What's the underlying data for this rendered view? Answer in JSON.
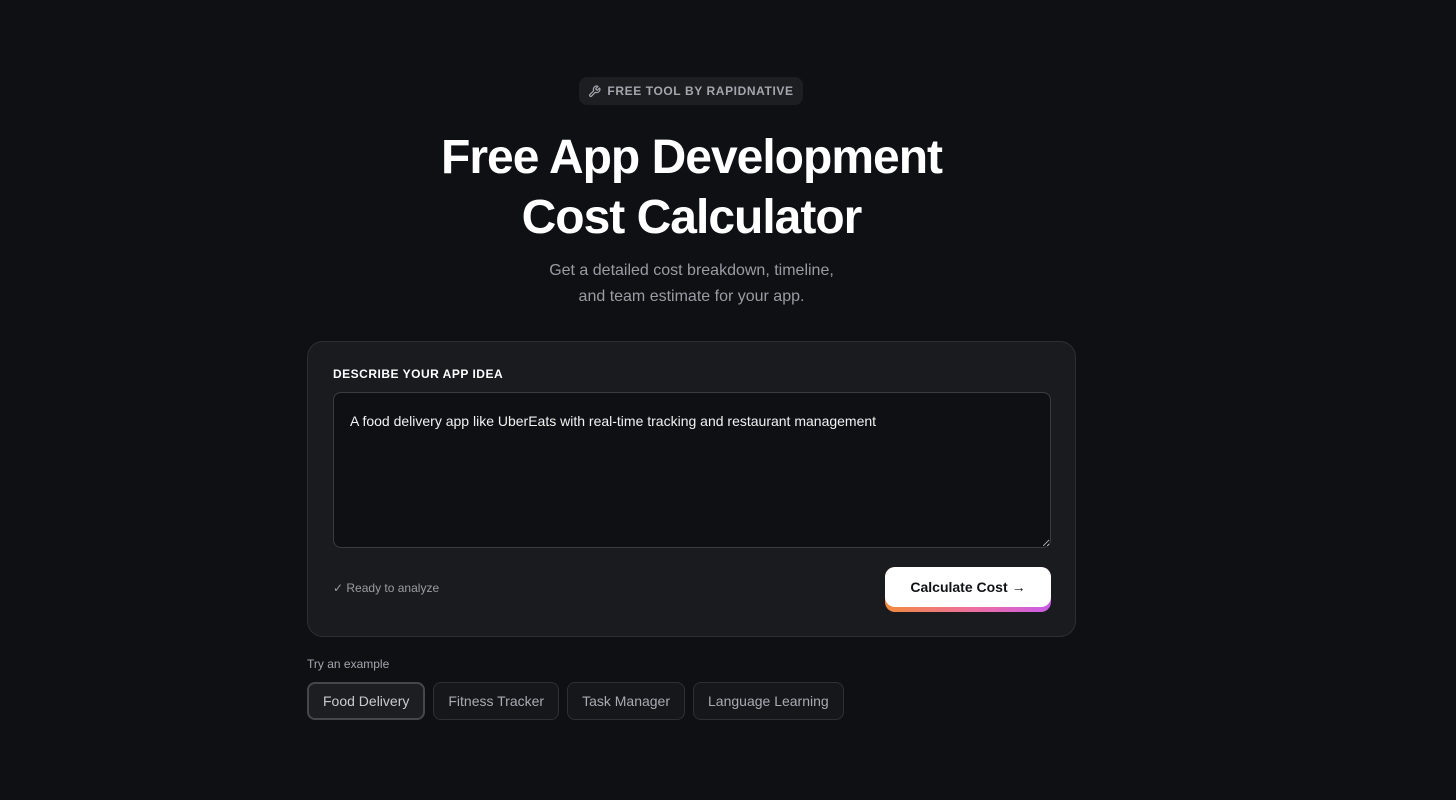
{
  "badge": {
    "icon": "wrench-icon",
    "label": "FREE TOOL BY RAPIDNATIVE"
  },
  "hero": {
    "title_line1": "Free App Development",
    "title_line2": "Cost Calculator",
    "subtitle_line1": "Get a detailed cost breakdown, timeline,",
    "subtitle_line2": "and team estimate for your app."
  },
  "form": {
    "label": "DESCRIBE YOUR APP IDEA",
    "idea_value": "A food delivery app like UberEats with real-time tracking and restaurant management",
    "status": "✓ Ready to analyze",
    "submit_label": "Calculate Cost",
    "submit_arrow": "→"
  },
  "examples": {
    "label": "Try an example",
    "items": [
      {
        "label": "Food Delivery",
        "selected": true
      },
      {
        "label": "Fitness Tracker",
        "selected": false
      },
      {
        "label": "Task Manager",
        "selected": false
      },
      {
        "label": "Language Learning",
        "selected": false
      }
    ]
  },
  "colors": {
    "background": "#0e1014",
    "card": "#1a1b1e",
    "button_gradient_start": "#f28a3c",
    "button_gradient_mid": "#ec6ea3",
    "button_gradient_end": "#c95ce8"
  }
}
